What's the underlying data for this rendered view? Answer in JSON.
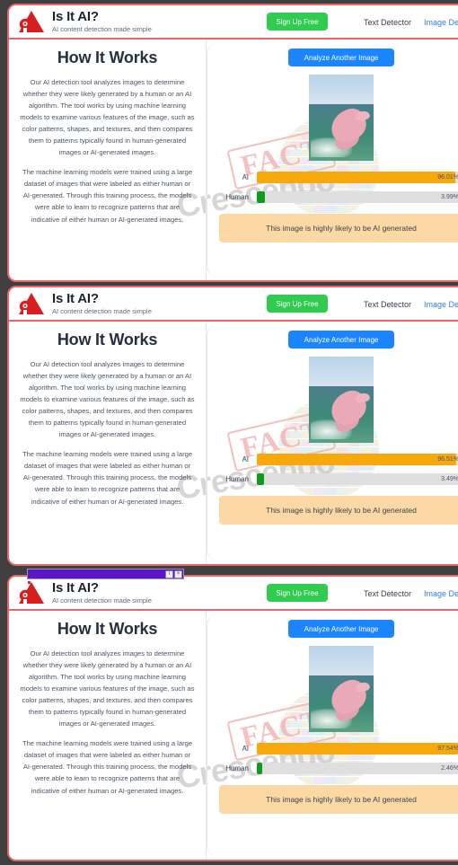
{
  "page": {
    "background": "#3f3f3f",
    "panel_border_color": "#e8656a"
  },
  "header": {
    "logo_icon": "red-triangle-robot-logo",
    "title": "Is It AI?",
    "subtitle": "AI content detection made simple",
    "signup_label": "Sign Up Free",
    "signup_color": "#2fcc4f",
    "nav": [
      {
        "label": "Text Detector",
        "active": false
      },
      {
        "label": "Image Dete",
        "active": true
      }
    ]
  },
  "how_it_works": {
    "title": "How It Works",
    "paragraphs": [
      "Our AI detection tool analyzes images to determine whether they were likely generated by a human or an AI algorithm. The tool works by using machine learning models to examine various features of the image, such as color patterns, shapes, and textures, and then compares them to patterns typically found in human-generated images or AI-generated images.",
      "The machine learning models were trained using a large dataset of images that were labeled as either human or AI-generated. Through this training process, the models were able to learn to recognize patterns that are indicative of either human or AI-generated images."
    ]
  },
  "results": {
    "analyze_button": "Analyze Another Image",
    "analyze_color": "#1a85ff",
    "image_alt": "pink-dolphin-jumping-photo",
    "ai_label": "AI",
    "human_label": "Human",
    "ai_color": "#f7a80d",
    "human_color": "#0f9b1f",
    "verdict": "This image is highly likely to be AI generated",
    "verdict_bg": "#fcd9a4"
  },
  "panels": [
    {
      "ai_pct": "96.01%",
      "human_pct": "3.99%",
      "ai_value": 96.01,
      "human_value": 3.99
    },
    {
      "ai_pct": "96.51%",
      "human_pct": "3.49%",
      "ai_value": 96.51,
      "human_value": 3.49
    },
    {
      "ai_pct": "97.54%",
      "human_pct": "2.46%",
      "ai_value": 97.54,
      "human_value": 2.46
    }
  ],
  "watermark": {
    "brand_top": "FACT",
    "brand_bottom": "Crescendo"
  },
  "download_bar": {
    "progress_color": "#5c14c9",
    "info_icon": "info-icon",
    "close_icon": "close-icon",
    "info_glyph": "i",
    "close_glyph": "×"
  }
}
